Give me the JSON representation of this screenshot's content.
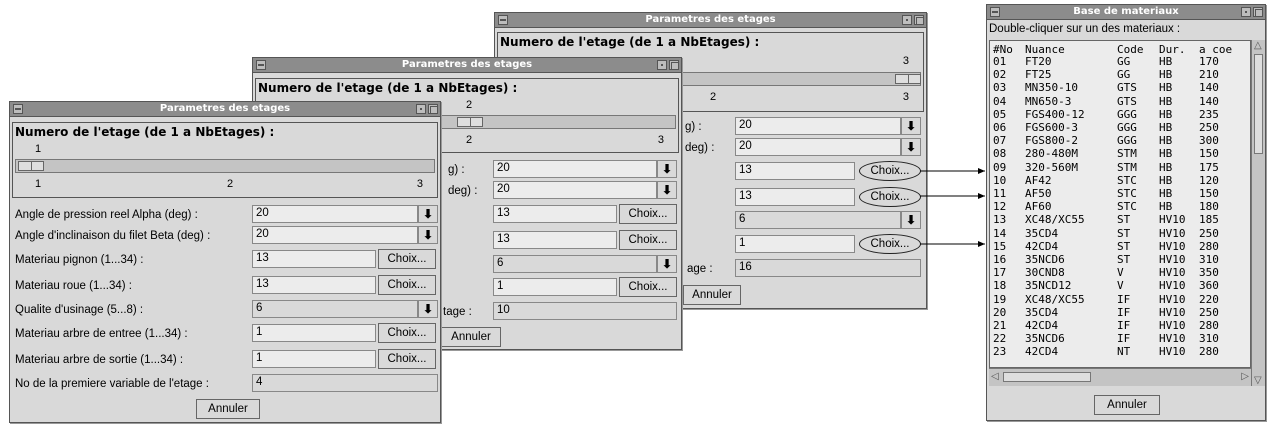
{
  "dialog": {
    "title": "Parametres des etages",
    "scale_label": "Numero de l'etage (de 1 a NbEtages) :",
    "tick_min": "1",
    "tick_mid": "2",
    "tick_max": "3",
    "choix_label": "Choix...",
    "cancel_label": "Annuler"
  },
  "win1": {
    "stage_value": "1",
    "fields": {
      "alpha": {
        "label": "Angle de pression reel Alpha (deg) :",
        "value": "20"
      },
      "beta": {
        "label": "Angle d'inclinaison du filet Beta (deg) :",
        "value": "20"
      },
      "pignon": {
        "label": "Materiau pignon (1...34) :",
        "value": "13"
      },
      "roue": {
        "label": "Materiau roue (1...34) :",
        "value": "13"
      },
      "qualite": {
        "label": "Qualite d'usinage (5...8) :",
        "value": "6"
      },
      "arbre_in": {
        "label": "Materiau arbre de entree (1...34) :",
        "value": "1"
      },
      "arbre_out": {
        "label": "Materiau arbre de sortie (1...34) :",
        "value": "1"
      },
      "premvar": {
        "label": "No de la premiere variable de l'etage :",
        "value": "4"
      }
    }
  },
  "win2": {
    "stage_value": "2",
    "frag_beta": "deg) :",
    "frag_alpha": "g) :",
    "frag_premvar": "tage :",
    "values": {
      "alpha": "20",
      "beta": "20",
      "pignon": "13",
      "roue": "13",
      "qualite": "6",
      "arbre": "1",
      "premvar": "10"
    }
  },
  "win3": {
    "stage_value": "3",
    "frag_alpha": "g) :",
    "frag_beta": "deg) :",
    "frag_premvar": "age :",
    "values": {
      "alpha": "20",
      "beta": "20",
      "pignon": "13",
      "roue": "13",
      "qualite": "6",
      "arbre": "1",
      "premvar": "16"
    }
  },
  "materials": {
    "title": "Base de materiaux",
    "instruction": "Double-cliquer sur un des materiaux :",
    "header": {
      "no": "#No",
      "nuance": "Nuance",
      "code": "Code",
      "dur": "Dur.",
      "coe": "a coe"
    },
    "rows": [
      [
        "01",
        "FT20",
        "GG",
        "HB",
        "170"
      ],
      [
        "02",
        "FT25",
        "GG",
        "HB",
        "210"
      ],
      [
        "03",
        "MN350-10",
        "GTS",
        "HB",
        "140"
      ],
      [
        "04",
        "MN650-3",
        "GTS",
        "HB",
        "140"
      ],
      [
        "05",
        "FGS400-12",
        "GGG",
        "HB",
        "235"
      ],
      [
        "06",
        "FGS600-3",
        "GGG",
        "HB",
        "250"
      ],
      [
        "07",
        "FGS800-2",
        "GGG",
        "HB",
        "300"
      ],
      [
        "08",
        "280-480M",
        "STM",
        "HB",
        "150"
      ],
      [
        "09",
        "320-560M",
        "STM",
        "HB",
        "175"
      ],
      [
        "10",
        "AF42",
        "STC",
        "HB",
        "120"
      ],
      [
        "11",
        "AF50",
        "STC",
        "HB",
        "150"
      ],
      [
        "12",
        "AF60",
        "STC",
        "HB",
        "180"
      ],
      [
        "13",
        "XC48/XC55",
        "ST",
        "HV10",
        "185"
      ],
      [
        "14",
        "35CD4",
        "ST",
        "HV10",
        "250"
      ],
      [
        "15",
        "42CD4",
        "ST",
        "HV10",
        "280"
      ],
      [
        "16",
        "35NCD6",
        "ST",
        "HV10",
        "310"
      ],
      [
        "17",
        "30CND8",
        "V",
        "HV10",
        "350"
      ],
      [
        "18",
        "35NCD12",
        "V",
        "HV10",
        "360"
      ],
      [
        "19",
        "XC48/XC55",
        "IF",
        "HV10",
        "220"
      ],
      [
        "20",
        "35CD4",
        "IF",
        "HV10",
        "250"
      ],
      [
        "21",
        "42CD4",
        "IF",
        "HV10",
        "280"
      ],
      [
        "22",
        "35NCD6",
        "IF",
        "HV10",
        "310"
      ],
      [
        "23",
        "42CD4",
        "NT",
        "HV10",
        "280"
      ]
    ],
    "cancel_label": "Annuler"
  }
}
